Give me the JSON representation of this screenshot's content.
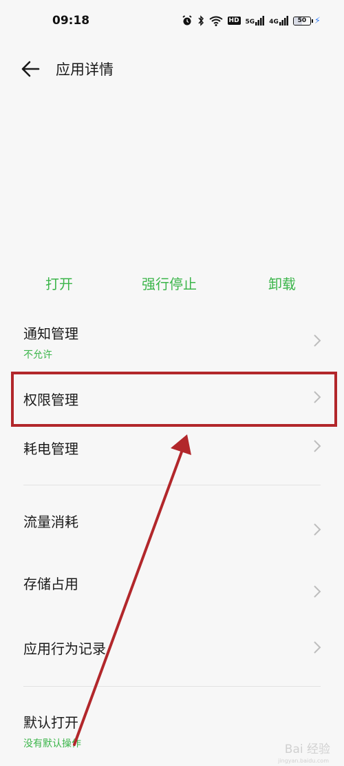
{
  "status_bar": {
    "time": "09:18",
    "wifi_label": "HD",
    "net1": "5G",
    "net2": "4G",
    "battery_level": "50",
    "battery_fraction": 0.5
  },
  "header": {
    "title": "应用详情"
  },
  "actions": {
    "open": "打开",
    "force_stop": "强行停止",
    "uninstall": "卸载"
  },
  "items": [
    {
      "label": "通知管理",
      "sub": "不允许"
    },
    {
      "label": "权限管理"
    },
    {
      "label": "耗电管理"
    },
    {
      "label": "流量消耗"
    },
    {
      "label": "存储占用"
    },
    {
      "label": "应用行为记录"
    },
    {
      "label": "默认打开",
      "sub": "没有默认操作"
    }
  ],
  "colors": {
    "accent": "#3bb54a",
    "highlight": "#b2272b",
    "background": "#f7f7f7"
  },
  "watermark": {
    "text": "Bai 经验",
    "sub": "jingyan.baidu.com"
  }
}
